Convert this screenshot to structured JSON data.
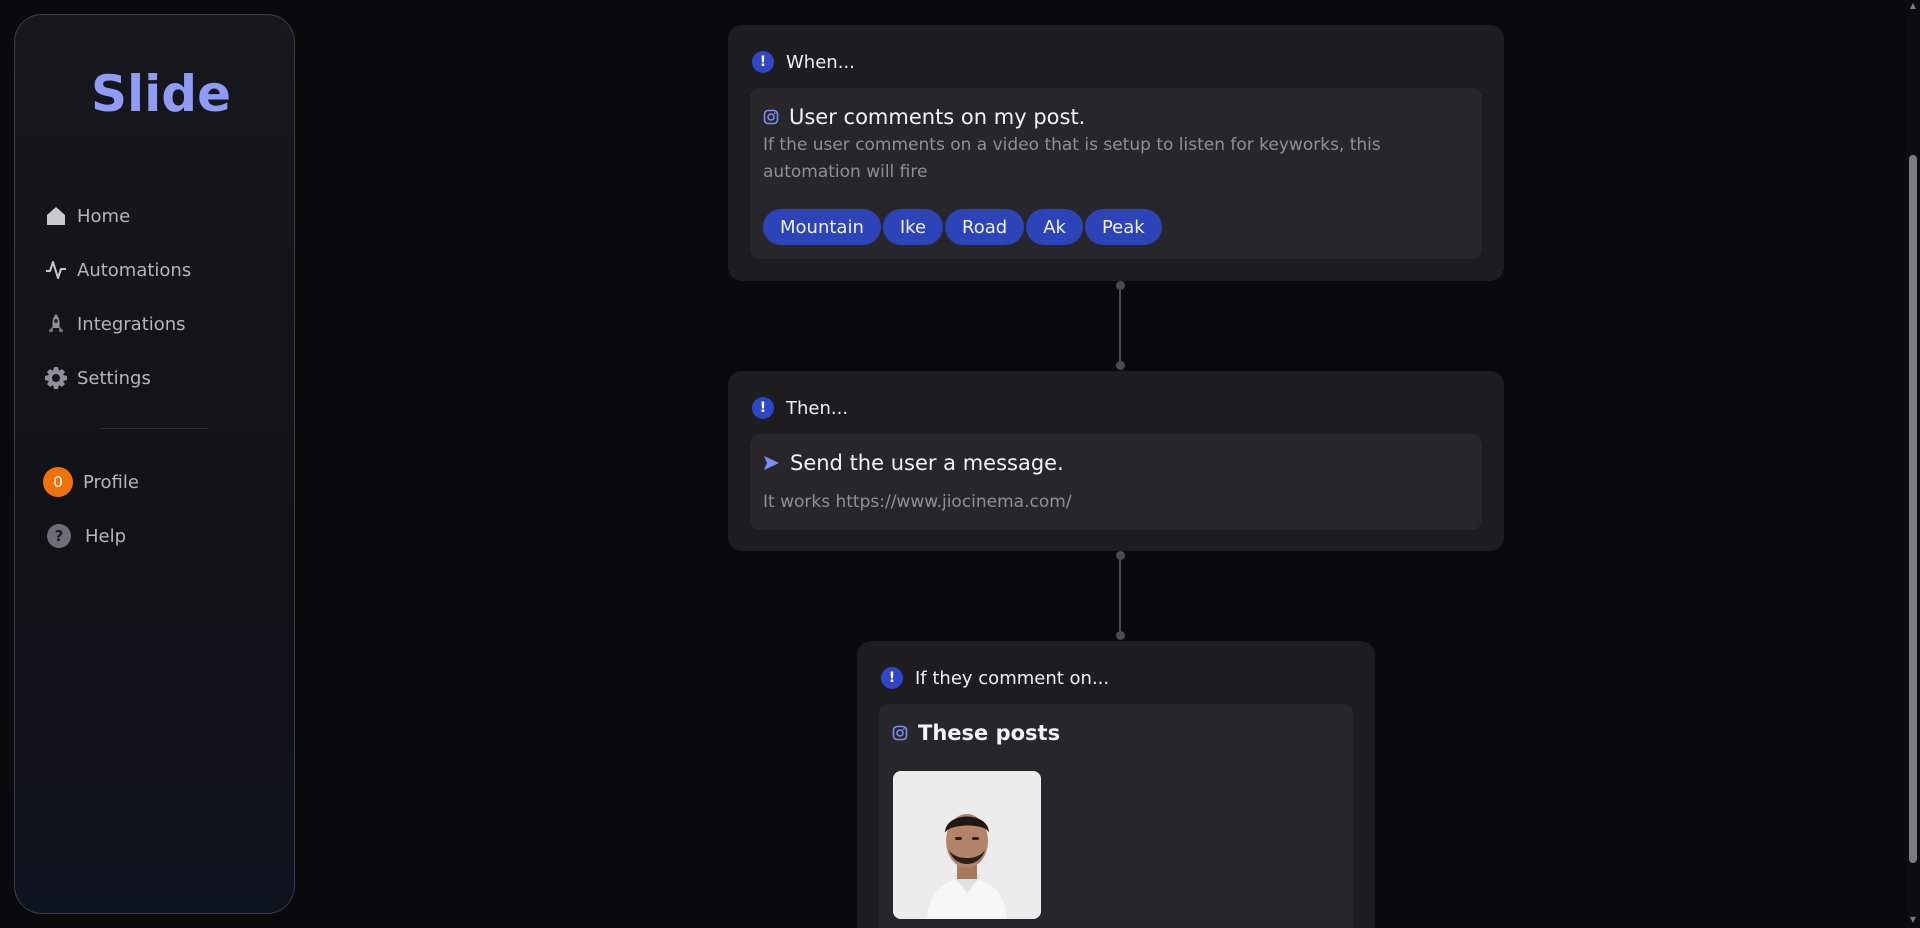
{
  "app": {
    "logo_text": "Slide"
  },
  "sidebar": {
    "items": [
      {
        "label": "Home",
        "icon": "home-icon"
      },
      {
        "label": "Automations",
        "icon": "activity-icon"
      },
      {
        "label": "Integrations",
        "icon": "rocket-icon"
      },
      {
        "label": "Settings",
        "icon": "gear-icon"
      }
    ],
    "profile": {
      "label": "Profile",
      "avatar_initial": "0"
    },
    "help": {
      "label": "Help",
      "icon_glyph": "?"
    }
  },
  "trigger_card": {
    "header": "When...",
    "title": "User comments on my post.",
    "description": "If the user comments on a video that is setup to listen for keyworks, this automation will fire",
    "keywords": [
      "Mountain",
      "Ike",
      "Road",
      "Ak",
      "Peak"
    ]
  },
  "action_card": {
    "header": "Then...",
    "title": "Send the user a message.",
    "message": "It works https://www.jiocinema.com/"
  },
  "posts_card": {
    "header": "If they comment on...",
    "title": "These posts"
  },
  "colors": {
    "accent": "#2f46c8",
    "chip": "#2c44b8",
    "logo": "#8f9cf5",
    "avatar": "#f0700a"
  }
}
